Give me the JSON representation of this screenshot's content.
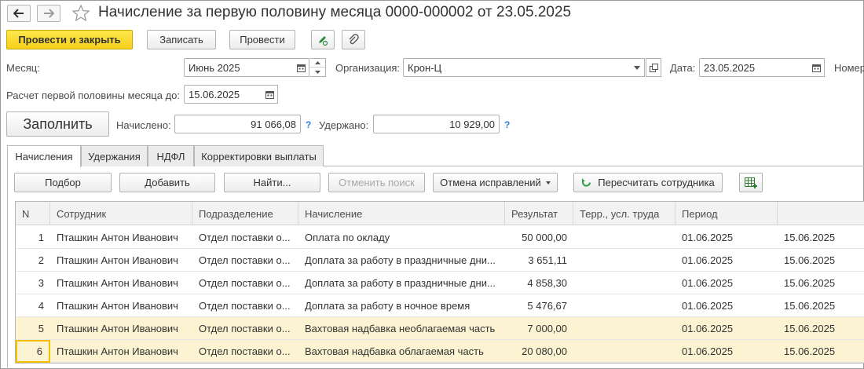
{
  "window": {
    "title": "Начисление за первую половину месяца 0000-000002 от 23.05.2025"
  },
  "toolbar": {
    "post_close_label": "Провести и закрыть",
    "save_label": "Записать",
    "post_label": "Провести"
  },
  "form": {
    "month_label": "Месяц:",
    "month_value": "Июнь 2025",
    "org_label": "Организация:",
    "org_value": "Крон-Ц",
    "date_label": "Дата:",
    "date_value": "23.05.2025",
    "number_label": "Номер",
    "calc_until_label": "Расчет первой половины месяца до:",
    "calc_until_value": "15.06.2025",
    "fill_label": "Заполнить",
    "accrued_label": "Начислено:",
    "accrued_value": "91 066,08",
    "withheld_label": "Удержано:",
    "withheld_value": "10 929,00",
    "help_mark": "?"
  },
  "tabs": [
    {
      "label": "Начисления",
      "active": true
    },
    {
      "label": "Удержания",
      "active": false
    },
    {
      "label": "НДФЛ",
      "active": false
    },
    {
      "label": "Корректировки выплаты",
      "active": false
    }
  ],
  "table_toolbar": {
    "select_label": "Подбор",
    "add_label": "Добавить",
    "find_label": "Найти...",
    "cancel_search_label": "Отменить поиск",
    "cancel_corrections_label": "Отмена исправлений",
    "recalc_label": "Пересчитать сотрудника"
  },
  "table": {
    "columns": [
      "N",
      "Сотрудник",
      "Подразделение",
      "Начисление",
      "Результат",
      "Терр., усл. труда",
      "Период",
      ""
    ],
    "rows": [
      [
        "1",
        "Пташкин Антон Иванович",
        "Отдел поставки о...",
        "Оплата по окладу",
        "50 000,00",
        "",
        "01.06.2025",
        "15.06.2025"
      ],
      [
        "2",
        "Пташкин Антон Иванович",
        "Отдел поставки о...",
        "Доплата за работу в праздничные дни...",
        "3 651,11",
        "",
        "01.06.2025",
        "15.06.2025"
      ],
      [
        "3",
        "Пташкин Антон Иванович",
        "Отдел поставки о...",
        "Доплата за работу в праздничные дни...",
        "4 858,30",
        "",
        "01.06.2025",
        "15.06.2025"
      ],
      [
        "4",
        "Пташкин Антон Иванович",
        "Отдел поставки о...",
        "Доплата за работу в ночное время",
        "5 476,67",
        "",
        "01.06.2025",
        "15.06.2025"
      ],
      [
        "5",
        "Пташкин Антон Иванович",
        "Отдел поставки о...",
        "Вахтовая надбавка необлагаемая часть",
        "7 000,00",
        "",
        "01.06.2025",
        "15.06.2025"
      ],
      [
        "6",
        "Пташкин Антон Иванович",
        "Отдел поставки о...",
        "Вахтовая надбавка облагаемая часть",
        "20 080,00",
        "",
        "01.06.2025",
        "15.06.2025"
      ]
    ],
    "highlighted_rows": [
      4,
      5
    ],
    "selected_row": 5
  },
  "colors": {
    "primary_button": "#f5cf19",
    "highlight_row": "#fbf3d1",
    "help_mark": "#2f7fd1",
    "recalc_icon": "#2ea043"
  }
}
